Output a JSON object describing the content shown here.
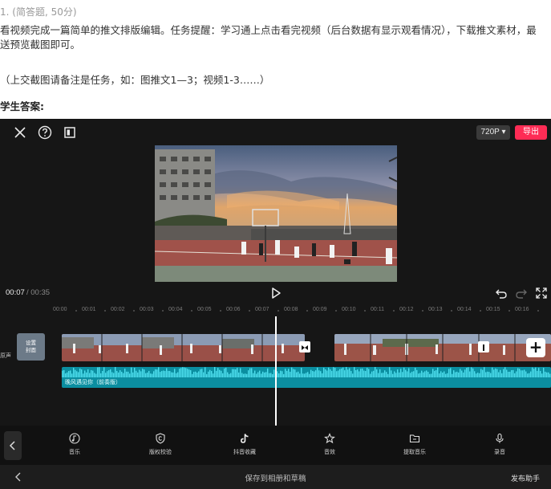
{
  "question": {
    "number": "1.",
    "type_score": "(简答题, 50分)",
    "text_line1": "看视频完成一篇简单的推文排版编辑。任务提醒：学习通上点击看完视频（后台数据有显示观看情况），下载推文素材，最",
    "text_line2": "送预览截图即可。",
    "note": "（上交截图请备注是任务，如：图推文1—3；视频1-3……）",
    "answer_label": "学生答案:"
  },
  "editor": {
    "resolution": "720P ▾",
    "export_label": "导出",
    "time_current": "00:07",
    "time_total": " / 00:35",
    "ruler_ticks": [
      "00:00",
      "00:01",
      "00:02",
      "00:03",
      "00:04",
      "00:05",
      "00:06",
      "00:07",
      "00:08",
      "00:09",
      "00:10",
      "00:11",
      "00:12",
      "00:13",
      "00:14",
      "00:15",
      "00:16"
    ],
    "track_label": "原声",
    "cover_label": "设置\n封面",
    "audio_label": "晚风遇见你（前奏版）",
    "tools": [
      {
        "label": "音乐",
        "icon": "music-note-icon"
      },
      {
        "label": "版权校验",
        "icon": "copyright-shield-icon"
      },
      {
        "label": "抖音收藏",
        "icon": "tiktok-icon"
      },
      {
        "label": "音效",
        "icon": "star-effect-icon"
      },
      {
        "label": "提取音乐",
        "icon": "folder-icon"
      },
      {
        "label": "录音",
        "icon": "microphone-icon"
      }
    ],
    "save_label": "保存到相册和草稿",
    "publish_label": "发布助手"
  },
  "colors": {
    "export": "#fe2c55",
    "audio_track": "#0b8ea0",
    "background": "#161616"
  }
}
